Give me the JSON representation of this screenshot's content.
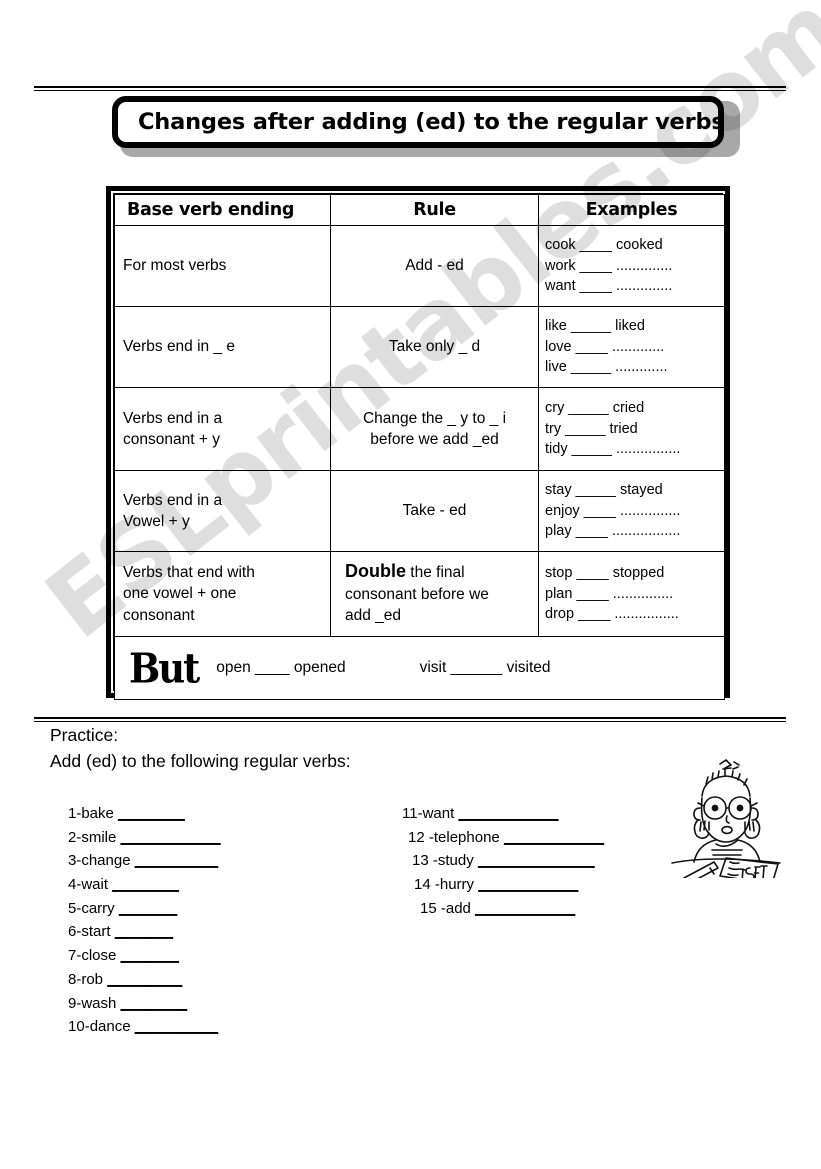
{
  "watermark": {
    "text": "ESLprintables.com"
  },
  "title": {
    "text": "Changes after adding (ed) to the regular verbs"
  },
  "table": {
    "headers": [
      "Base verb ending",
      "Rule",
      "Examples"
    ],
    "rows": [
      {
        "base": "For most verbs",
        "rule": "Add - ed",
        "examples": [
          {
            "verb": "cook",
            "blank": "____",
            "answer": "cooked"
          },
          {
            "verb": "work",
            "blank": "____",
            "answer": ".............."
          },
          {
            "verb": "want",
            "blank": "____",
            "answer": ".............."
          }
        ]
      },
      {
        "base": "Verbs end in _ e",
        "rule": "Take only _ d",
        "examples": [
          {
            "verb": "like",
            "blank": "_____",
            "answer": "liked"
          },
          {
            "verb": "love",
            "blank": "____",
            "answer": "............."
          },
          {
            "verb": "live",
            "blank": "_____",
            "answer": "............."
          }
        ]
      },
      {
        "base": " Verbs end in a\nconsonant + y",
        "rule": "Change the _ y to _ i\nbefore we add  _ed",
        "examples": [
          {
            "verb": "cry",
            "blank": "_____",
            "answer": "cried"
          },
          {
            "verb": "try",
            "blank": "_____",
            "answer": "tried"
          },
          {
            "verb": "tidy",
            "blank": "_____",
            "answer": "................"
          }
        ]
      },
      {
        "base": "Verbs end in a\n  Vowel + y",
        "rule": "Take  - ed",
        "examples": [
          {
            "verb": "stay",
            "blank": "_____",
            "answer": "stayed"
          },
          {
            "verb": "enjoy",
            "blank": "____",
            "answer": "..............."
          },
          {
            "verb": "play",
            "blank": "____",
            "answer": "................."
          }
        ]
      },
      {
        "base": "Verbs that end with\none vowel + one\nconsonant",
        "rule_bold": "Double",
        "rule_rest": " the final\nconsonant before we\nadd _ed",
        "examples": [
          {
            "verb": "stop",
            "blank": "____",
            "answer": "stopped"
          },
          {
            "verb": "plan",
            "blank": "____",
            "answer": "..............."
          },
          {
            "verb": "drop",
            "blank": "____",
            "answer": "................"
          }
        ]
      }
    ],
    "but_row": {
      "label": "But",
      "pair1": "open ____ opened",
      "pair2": "visit ______ visited"
    }
  },
  "practice": {
    "heading": "Practice:",
    "instruction": "Add (ed) to  the following regular verbs:",
    "left_items": [
      {
        "num": "1-",
        "verb": "bake",
        "blank": "________"
      },
      {
        "num": "2-",
        "verb": "smile",
        "blank": "____________"
      },
      {
        "num": "3-",
        "verb": "change",
        "blank": "__________"
      },
      {
        "num": "4-",
        "verb": "wait",
        "blank": "________"
      },
      {
        "num": "5-",
        "verb": "carry",
        "blank": "_______"
      },
      {
        "num": "6-",
        "verb": "start",
        "blank": "_______"
      },
      {
        "num": "7-",
        "verb": "close",
        "blank": "_______"
      },
      {
        "num": "8-",
        "verb": "rob",
        "blank": "_________"
      },
      {
        "num": "9-",
        "verb": "wash",
        "blank": "________"
      },
      {
        "num": "10-",
        "verb": "dance",
        "blank": "__________"
      }
    ],
    "right_items": [
      {
        "num": "11-",
        "verb": "want",
        "blank": "____________",
        "indent": 0
      },
      {
        "num": "12 -",
        "verb": "telephone",
        "blank": "____________",
        "indent": 6
      },
      {
        "num": "13 -",
        "verb": "study",
        "blank": "______________",
        "indent": 10
      },
      {
        "num": "14 -",
        "verb": "hurry",
        "blank": "____________",
        "indent": 12
      },
      {
        "num": "15 -",
        "verb": "add",
        "blank": "____________",
        "indent": 18
      }
    ]
  },
  "clipart": {
    "name": "stressed-student-at-desk",
    "paper_label": "TEST"
  }
}
